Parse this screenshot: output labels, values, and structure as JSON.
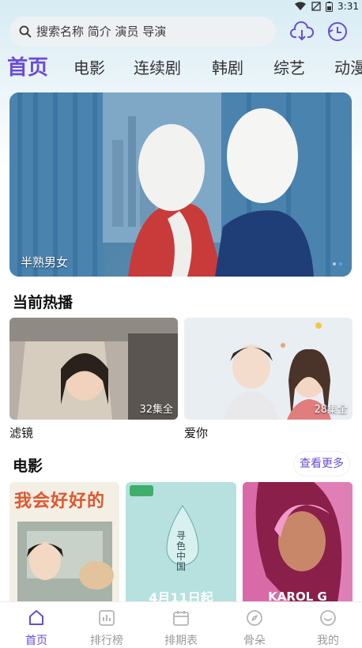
{
  "status_bar": {
    "time": "3:31"
  },
  "search": {
    "placeholder": "搜索名称 简介 演员 导演"
  },
  "tabs": [
    {
      "label": "首页",
      "active": true
    },
    {
      "label": "电影"
    },
    {
      "label": "连续剧"
    },
    {
      "label": "韩剧"
    },
    {
      "label": "综艺"
    },
    {
      "label": "动漫"
    }
  ],
  "banner": {
    "title": "半熟男女",
    "caption": "半熟男女"
  },
  "now_playing": {
    "title": "当前热播",
    "items": [
      {
        "title": "滤镜",
        "episodes": "32集全"
      },
      {
        "title": "爱你",
        "episodes": "28集全"
      }
    ]
  },
  "movies": {
    "title": "电影",
    "more_label": "查看更多",
    "items": [
      {
        "poster_text": "我会好好的"
      },
      {
        "poster_text": "寻色中国",
        "date": "4月11日起"
      },
      {
        "poster_text": "KAROL G"
      }
    ]
  },
  "bottom_nav": [
    {
      "label": "首页",
      "icon": "home-icon",
      "active": true
    },
    {
      "label": "排行榜",
      "icon": "ranking-icon"
    },
    {
      "label": "排期表",
      "icon": "calendar-icon"
    },
    {
      "label": "骨朵",
      "icon": "compass-icon"
    },
    {
      "label": "我的",
      "icon": "profile-icon"
    }
  ],
  "colors": {
    "accent": "#6a4bd8",
    "inactive": "#9a9a9a"
  }
}
